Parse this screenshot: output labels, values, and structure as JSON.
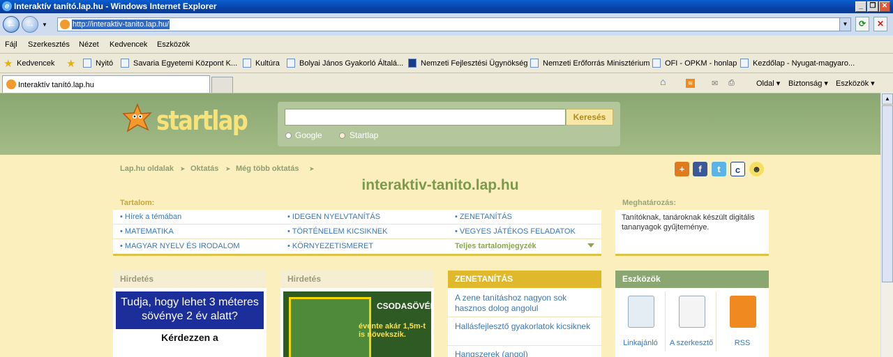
{
  "window": {
    "title": "Interaktív tanító.lap.hu - Windows Internet Explorer",
    "controls": [
      "_",
      "❐",
      "✕"
    ]
  },
  "address": {
    "url": "http://interaktiv-tanito.lap.hu/"
  },
  "menu": [
    "Fájl",
    "Szerkesztés",
    "Nézet",
    "Kedvencek",
    "Eszközök"
  ],
  "favorites": {
    "label": "Kedvencek",
    "items": [
      "Nyitó",
      "Savaria Egyetemi Központ K...",
      "Kultúra",
      "Bolyai János Gyakorló Általá...",
      "Nemzeti Fejlesztési Ügynökség",
      "Nemzeti Erőforrás Minisztérium",
      "OFI - OPKM - honlap",
      "Kezdőlap - Nyugat-magyaro..."
    ]
  },
  "tabs": [
    {
      "label": "Interaktív tanító.lap.hu"
    }
  ],
  "tools": {
    "page": "Oldal",
    "security": "Biztonság",
    "tools": "Eszközök"
  },
  "site": {
    "logo": "startlap",
    "search": {
      "button": "Keresés",
      "options": [
        "Google",
        "Startlap"
      ],
      "selected": "Startlap"
    },
    "breadcrumbs": [
      "Lap.hu oldalak",
      "Oktatás",
      "Még több oktatás"
    ],
    "title": "interaktiv-tanito.lap.hu",
    "content_heading": "Tartalom:",
    "content": [
      [
        "Hírek a témában",
        "IDEGEN NYELVTANÍTÁS",
        "ZENETANÍTÁS"
      ],
      [
        "MATEMATIKA",
        "TÖRTÉNELEM KICSIKNEK",
        "VEGYES JÁTÉKOS FELADATOK"
      ],
      [
        "MAGYAR NYELV ÉS IRODALOM",
        "KÖRNYEZETISMERET",
        "Teljes tartalomjegyzék"
      ]
    ],
    "definition_heading": "Meghatározás:",
    "definition": "Tanítóknak, tanároknak készült digitális tananyagok gyűjteménye.",
    "ad_label": "Hirdetés",
    "ad1": {
      "line1": "Tudja, hogy lehet 3 méteres sövénye 2 év alatt?",
      "line2": "Kérdezzen a"
    },
    "ad2": {
      "title": "CSODASÖVÉNY",
      "text": "évente akár 1,5m-t is növekszik."
    },
    "zene": {
      "heading": "ZENETANÍTÁS",
      "links": [
        "A zene tanításhoz nagyon sok hasznos dolog angolul",
        "Hallásfejlesztő gyakorlatok kicsiknek",
        "Hangszerek (angol)"
      ]
    },
    "tools_box": {
      "heading": "Eszközök",
      "items": [
        "Linkajánló",
        "A szerkesztő",
        "RSS"
      ]
    }
  }
}
